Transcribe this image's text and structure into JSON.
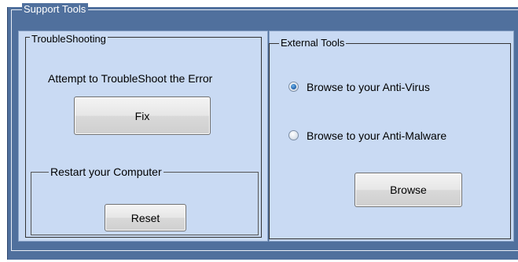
{
  "support_tools": {
    "title": "Support Tools"
  },
  "troubleshooting": {
    "title": "TroubleShooting",
    "description": "Attempt to TroubleShoot the Error",
    "fix_label": "Fix"
  },
  "restart": {
    "title": "Restart your Computer",
    "reset_label": "Reset"
  },
  "external_tools": {
    "title": "External Tools",
    "options": [
      {
        "label": "Browse to your Anti-Virus",
        "selected": true
      },
      {
        "label": "Browse to your Anti-Malware",
        "selected": false
      }
    ],
    "browse_label": "Browse"
  },
  "colors": {
    "outer_panel": "#50709d",
    "group_panel": "#c9daf3",
    "radio_selected": "#1f5fa8"
  }
}
